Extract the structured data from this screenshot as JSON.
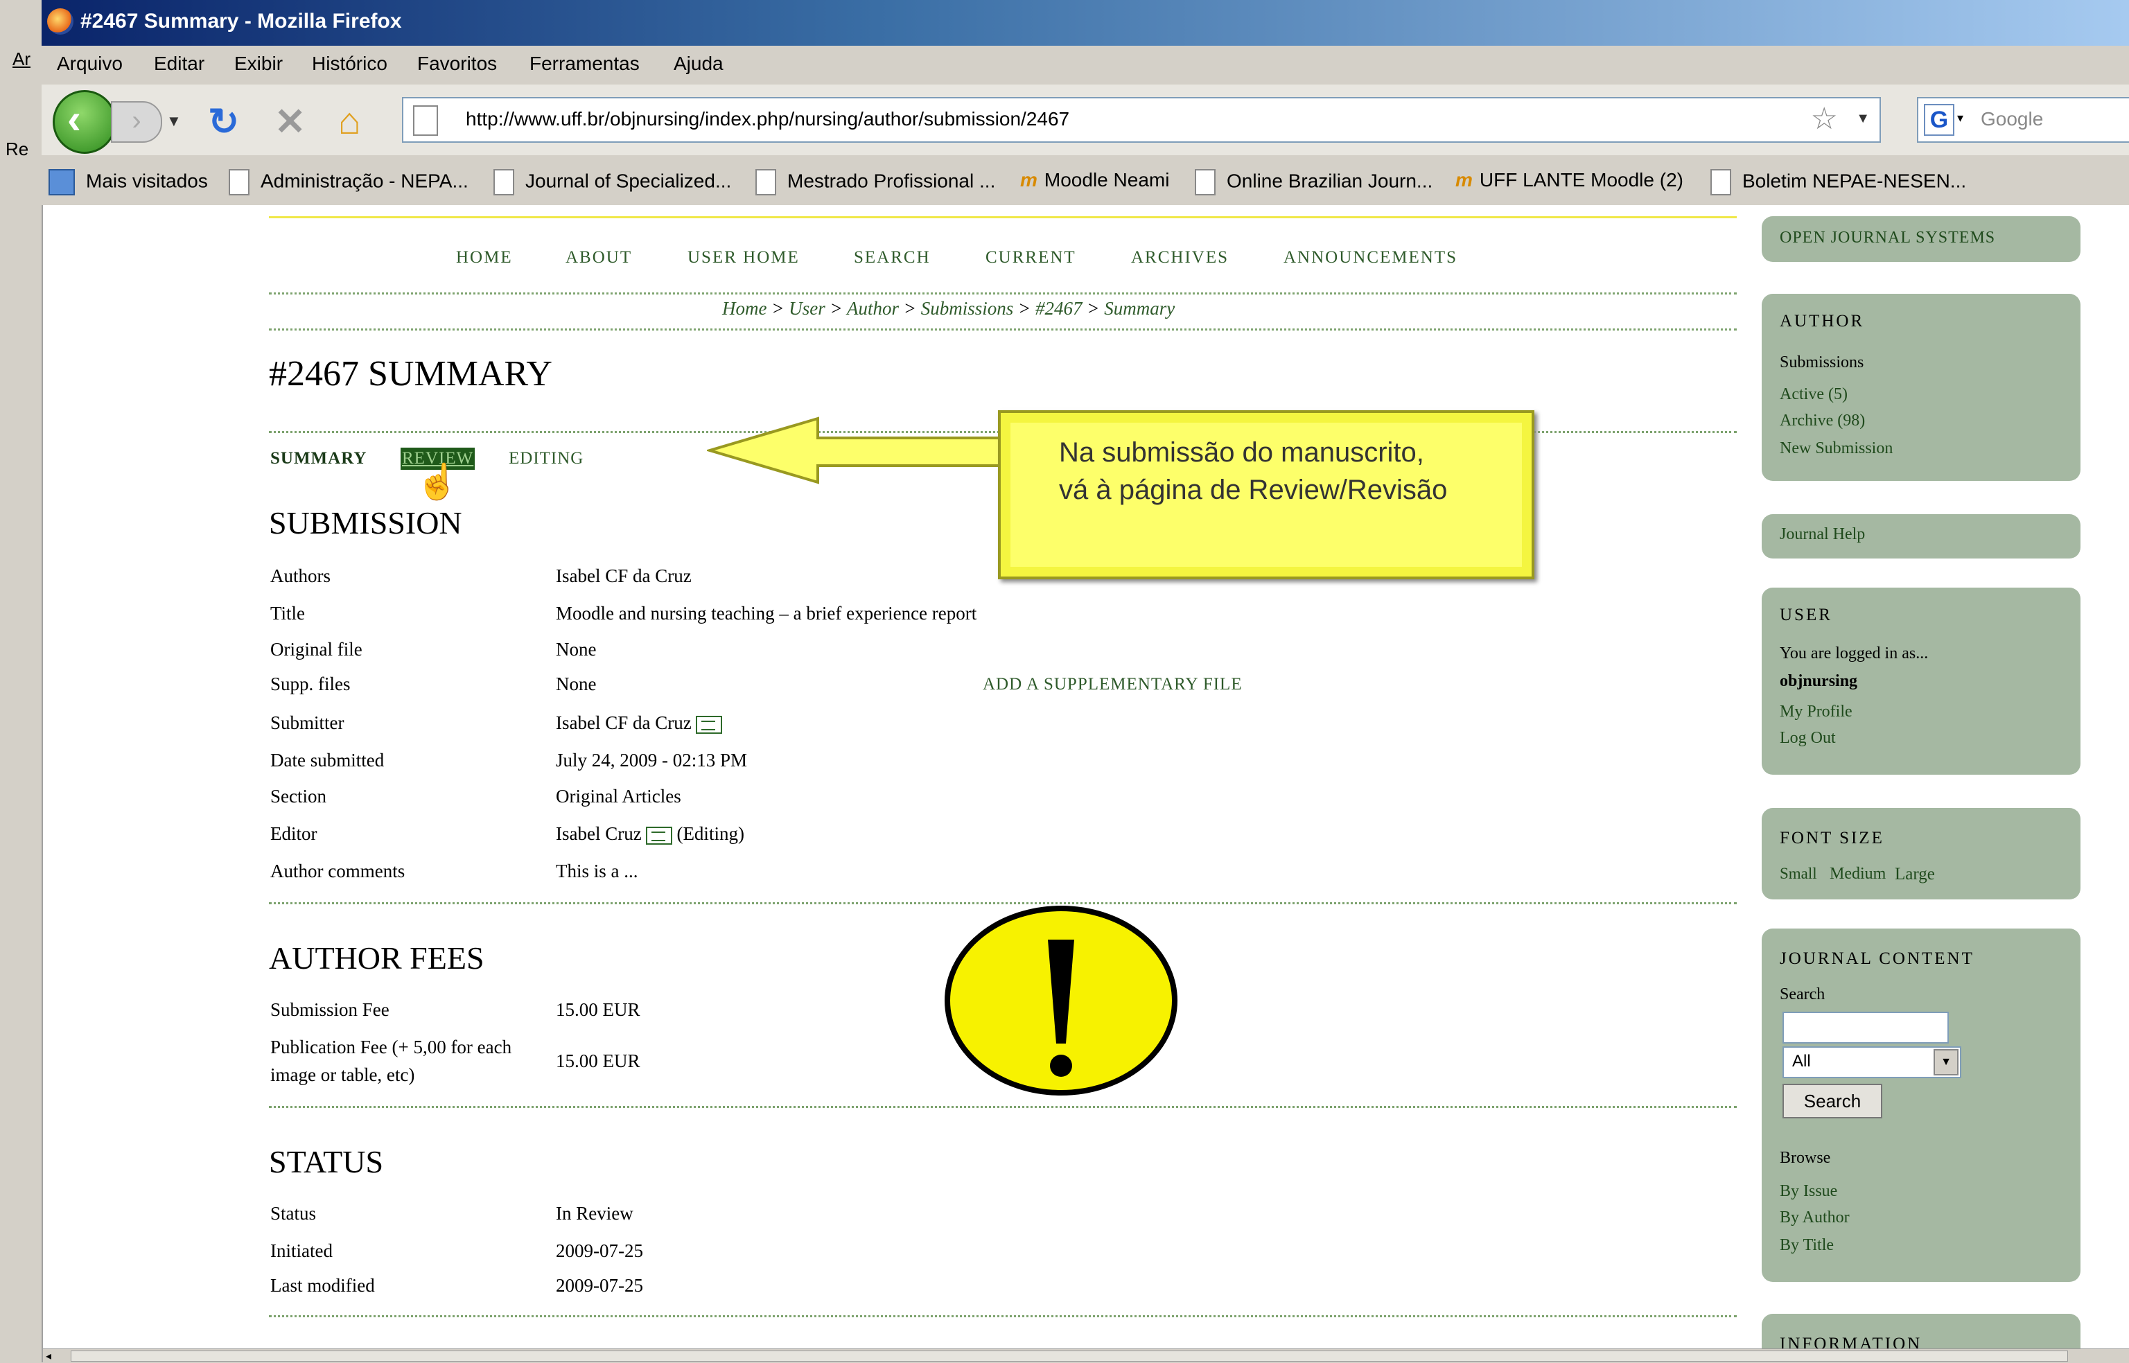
{
  "side_window": {
    "labels": [
      "Ar",
      "Re"
    ]
  },
  "window": {
    "title": "#2467 Summary - Mozilla Firefox"
  },
  "menu": [
    "Arquivo",
    "Editar",
    "Exibir",
    "Histórico",
    "Favoritos",
    "Ferramentas",
    "Ajuda"
  ],
  "address_bar": {
    "url": "http://www.uff.br/objnursing/index.php/nursing/author/submission/2467"
  },
  "search_bar": {
    "placeholder": "Google"
  },
  "bookmarks": [
    {
      "label": "Mais visitados",
      "icon": "smart-folder-icon"
    },
    {
      "label": "Administração - NEPA...",
      "icon": "page-icon"
    },
    {
      "label": "Journal of Specialized...",
      "icon": "page-icon"
    },
    {
      "label": "Mestrado Profissional ...",
      "icon": "page-icon"
    },
    {
      "label": "Moodle Neami",
      "icon": "moodle-icon"
    },
    {
      "label": "Online Brazilian Journ...",
      "icon": "page-icon"
    },
    {
      "label": "UFF LANTE Moodle (2)",
      "icon": "moodle-icon"
    },
    {
      "label": "Boletim NEPAE-NESEN...",
      "icon": "page-icon"
    }
  ],
  "site_nav": [
    "HOME",
    "ABOUT",
    "USER HOME",
    "SEARCH",
    "CURRENT",
    "ARCHIVES",
    "ANNOUNCEMENTS"
  ],
  "breadcrumb": {
    "home": "Home",
    "user": "User",
    "author": "Author",
    "submissions": "Submissions",
    "id": "#2467",
    "current": "Summary",
    "sep": ">"
  },
  "page_title": "#2467 SUMMARY",
  "tabs": {
    "summary": "SUMMARY",
    "review": "REVIEW",
    "editing": "EDITING"
  },
  "submission": {
    "heading": "SUBMISSION",
    "authors_label": "Authors",
    "authors": "Isabel CF da Cruz",
    "title_label": "Title",
    "title": "Moodle and nursing teaching – a brief experience report",
    "original_file_label": "Original file",
    "original_file": "None",
    "supp_files_label": "Supp. files",
    "supp_files": "None",
    "add_supp_link": "ADD A SUPPLEMENTARY FILE",
    "submitter_label": "Submitter",
    "submitter": "Isabel CF da Cruz",
    "date_label": "Date submitted",
    "date": "July 24, 2009 - 02:13 PM",
    "section_label": "Section",
    "section": "Original Articles",
    "editor_label": "Editor",
    "editor": "Isabel Cruz",
    "editor_role": "(Editing)",
    "comments_label": "Author comments",
    "comments": "This is a ..."
  },
  "fees": {
    "heading": "AUTHOR FEES",
    "submission_label": "Submission Fee",
    "submission": "15.00 EUR",
    "publication_label_1": "Publication Fee (+ 5,00 for each",
    "publication_label_2": "image or table, etc)",
    "publication": "15.00 EUR"
  },
  "status": {
    "heading": "STATUS",
    "status_label": "Status",
    "status": "In Review",
    "initiated_label": "Initiated",
    "initiated": "2009-07-25",
    "modified_label": "Last modified",
    "modified": "2009-07-25"
  },
  "callout": {
    "line1": "Na submissão do manuscrito,",
    "line2": "vá à página de Review/Revisão"
  },
  "sidebar": {
    "ojs": "OPEN JOURNAL SYSTEMS",
    "author_title": "AUTHOR",
    "submissions": "Submissions",
    "active": "Active (5)",
    "archive": "Archive (98)",
    "new_submission": "New Submission",
    "journal_help": "Journal Help",
    "user_title": "USER",
    "logged_in": "You are logged in as...",
    "username": "objnursing",
    "my_profile": "My Profile",
    "log_out": "Log Out",
    "font_title": "FONT SIZE",
    "font_small": "Small",
    "font_medium": "Medium",
    "font_large": "Large",
    "content_title": "JOURNAL CONTENT",
    "search_label": "Search",
    "scope": "All",
    "search_button": "Search",
    "browse_label": "Browse",
    "by_issue": "By Issue",
    "by_author": "By Author",
    "by_title": "By Title",
    "info_title": "INFORMATION"
  },
  "colors": {
    "accent_green": "#2e5a2a",
    "sidebar_bg": "#a5b8a2",
    "callout_yellow": "#fdff6a",
    "tab_highlight": "#1f5a1a"
  }
}
